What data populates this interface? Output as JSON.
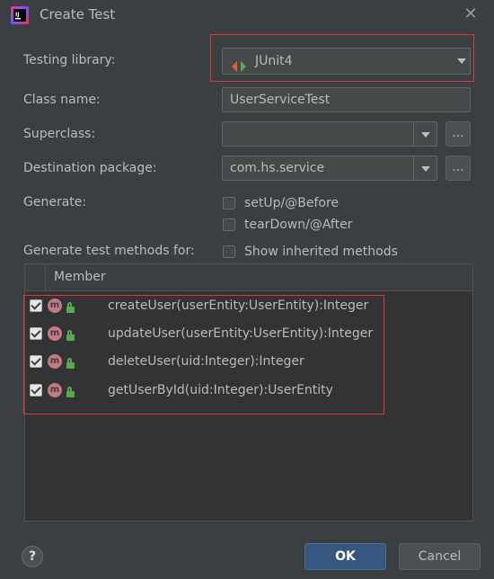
{
  "window": {
    "title": "Create Test",
    "close_glyph": "✕",
    "app_icon": "intellij-icon",
    "app_icon_text": "IJ"
  },
  "form": {
    "testing_library_label": "Testing library:",
    "testing_library_value": "JUnit4",
    "class_name_label": "Class name:",
    "class_name_value": "UserServiceTest",
    "superclass_label": "Superclass:",
    "superclass_value": "",
    "destination_label": "Destination package:",
    "destination_value": "com.hs.service",
    "browse_label": "...",
    "generate_label": "Generate:",
    "setup_label": "setUp/@Before",
    "setup_checked": false,
    "teardown_label": "tearDown/@After",
    "teardown_checked": false,
    "generate_methods_label": "Generate test methods for:",
    "show_inherited_label": "Show inherited methods",
    "show_inherited_checked": false
  },
  "table": {
    "header": "Member",
    "method_icon_text": "m",
    "rows": [
      {
        "label": "createUser(userEntity:UserEntity):Integer",
        "checked": true
      },
      {
        "label": "updateUser(userEntity:UserEntity):Integer",
        "checked": true
      },
      {
        "label": "deleteUser(uid:Integer):Integer",
        "checked": true
      },
      {
        "label": "getUserById(uid:Integer):UserEntity",
        "checked": true
      }
    ]
  },
  "footer": {
    "help_label": "?",
    "ok_label": "OK",
    "cancel_label": "Cancel"
  },
  "colors": {
    "accent_button": "#365880",
    "highlight_box": "#d83b3b",
    "background": "#3c3f41"
  }
}
